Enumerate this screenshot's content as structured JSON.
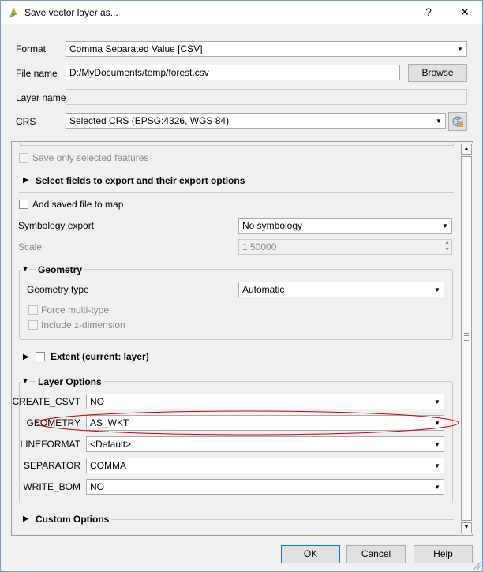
{
  "window": {
    "title": "Save vector layer as...",
    "help_btn": "?",
    "close_btn": "✕"
  },
  "top": {
    "format_label": "Format",
    "format_value": "Comma Separated Value [CSV]",
    "filename_label": "File name",
    "filename_value": "D:/MyDocuments/temp/forest.csv",
    "browse_btn": "Browse",
    "layername_label": "Layer name",
    "layername_value": "",
    "crs_label": "CRS",
    "crs_value": "Selected CRS (EPSG:4326, WGS 84)"
  },
  "panel": {
    "save_only_selected": "Save only selected features",
    "select_fields": "Select fields to export and their export options",
    "add_saved_file": "Add saved file to map",
    "symbology_label": "Symbology export",
    "symbology_value": "No symbology",
    "scale_label": "Scale",
    "scale_value": "1:50000",
    "geometry_group": "Geometry",
    "geometry_type_label": "Geometry type",
    "geometry_type_value": "Automatic",
    "force_multi": "Force multi-type",
    "include_z": "Include z-dimension",
    "extent_group": "Extent (current: layer)",
    "layer_options_group": "Layer Options",
    "options": [
      {
        "label": "CREATE_CSVT",
        "value": "NO"
      },
      {
        "label": "GEOMETRY",
        "value": "AS_WKT"
      },
      {
        "label": "LINEFORMAT",
        "value": "<Default>"
      },
      {
        "label": "SEPARATOR",
        "value": "COMMA"
      },
      {
        "label": "WRITE_BOM",
        "value": "NO"
      }
    ],
    "custom_options_group": "Custom Options"
  },
  "buttons": {
    "ok": "OK",
    "cancel": "Cancel",
    "help": "Help"
  },
  "colors": {
    "highlight_ellipse": "#cc0000",
    "accent": "#0078d7"
  }
}
